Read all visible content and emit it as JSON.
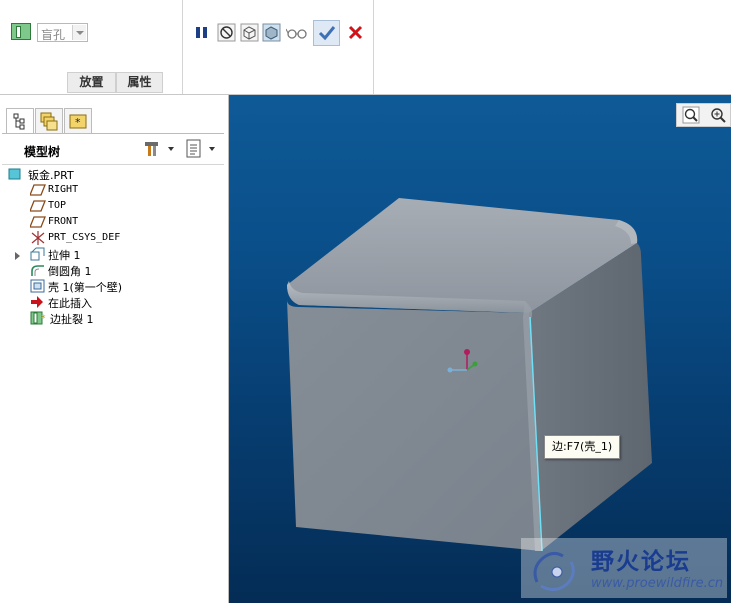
{
  "dashboard": {
    "feature_type_value": "盲孔",
    "tabs": [
      "放置",
      "属性"
    ],
    "toolbar_icons": [
      "pause-icon",
      "no-preview-icon",
      "verify-icon",
      "preview-icon",
      "glasses-icon",
      "ok-check-icon",
      "cancel-x-icon"
    ]
  },
  "panel": {
    "tabs": [
      "model-tree-tab-icon",
      "layers-tab-icon",
      "favorites-tab-icon"
    ],
    "tree_title": "模型树",
    "tree_items": [
      {
        "label": "钣金.PRT",
        "icon": "part-icon",
        "mono": false
      },
      {
        "label": "RIGHT",
        "icon": "datum-plane-icon",
        "mono": true
      },
      {
        "label": "TOP",
        "icon": "datum-plane-icon",
        "mono": true
      },
      {
        "label": "FRONT",
        "icon": "datum-plane-icon",
        "mono": true
      },
      {
        "label": "PRT_CSYS_DEF",
        "icon": "csys-icon",
        "mono": true
      },
      {
        "label": "拉伸 1",
        "icon": "extrude-icon",
        "mono": false
      },
      {
        "label": "倒圆角 1",
        "icon": "round-icon",
        "mono": false
      },
      {
        "label": "壳 1(第一个壁)",
        "icon": "shell-icon",
        "mono": false
      },
      {
        "label": "在此插入",
        "icon": "insert-here-arrow-icon",
        "mono": false
      },
      {
        "label": "边扯裂 1",
        "icon": "edge-rip-icon",
        "mono": false
      }
    ]
  },
  "viewport": {
    "tooltip": "边:F7(壳_1)",
    "zoom_icons": [
      "zoom-refit-icon",
      "zoom-in-icon"
    ],
    "watermark_title": "野火论坛",
    "watermark_url": "www.proewildfire.cn"
  },
  "colors": {
    "accent_check": "#2f6fd0",
    "cancel_red": "#d0141c",
    "background_top": "#0e5a97",
    "background_bottom": "#042c55",
    "model_face": "#7f8891"
  }
}
